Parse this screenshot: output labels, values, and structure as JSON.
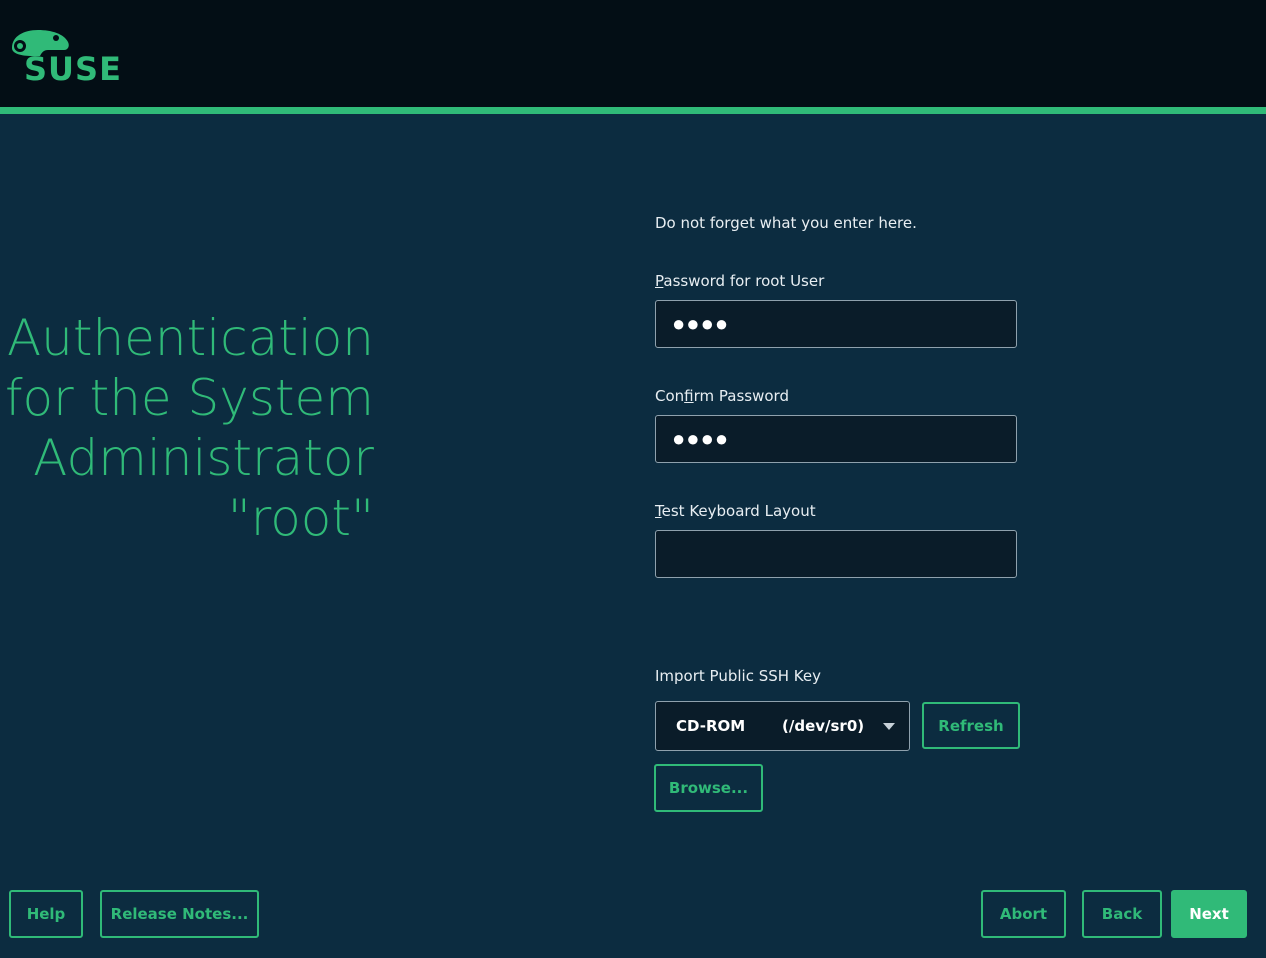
{
  "header": {
    "logo_text": "SUSE",
    "brand_color": "#30ba78"
  },
  "title": {
    "line1": "Authentication",
    "line2": "for the System",
    "line3": "Administrator",
    "line4": "\"root\""
  },
  "form": {
    "info": "Do not forget what you enter here.",
    "password_label_first": "P",
    "password_label_rest": "assword for root User",
    "password_value": "●●●●",
    "confirm_label_first": "Con",
    "confirm_label_u": "f",
    "confirm_label_rest": "irm Password",
    "confirm_value": "●●●●",
    "keyboard_label_first": "T",
    "keyboard_label_rest": "est Keyboard Layout",
    "keyboard_value": "",
    "ssh_label": "Import Public SSH Key",
    "ssh_device": "CD-ROM",
    "ssh_device_path": "(/dev/sr0)",
    "refresh_label": "Refresh",
    "browse_label": "Browse..."
  },
  "footer": {
    "help": "Help",
    "release_notes": "Release Notes...",
    "abort": "Abort",
    "back": "Back",
    "next": "Next"
  }
}
